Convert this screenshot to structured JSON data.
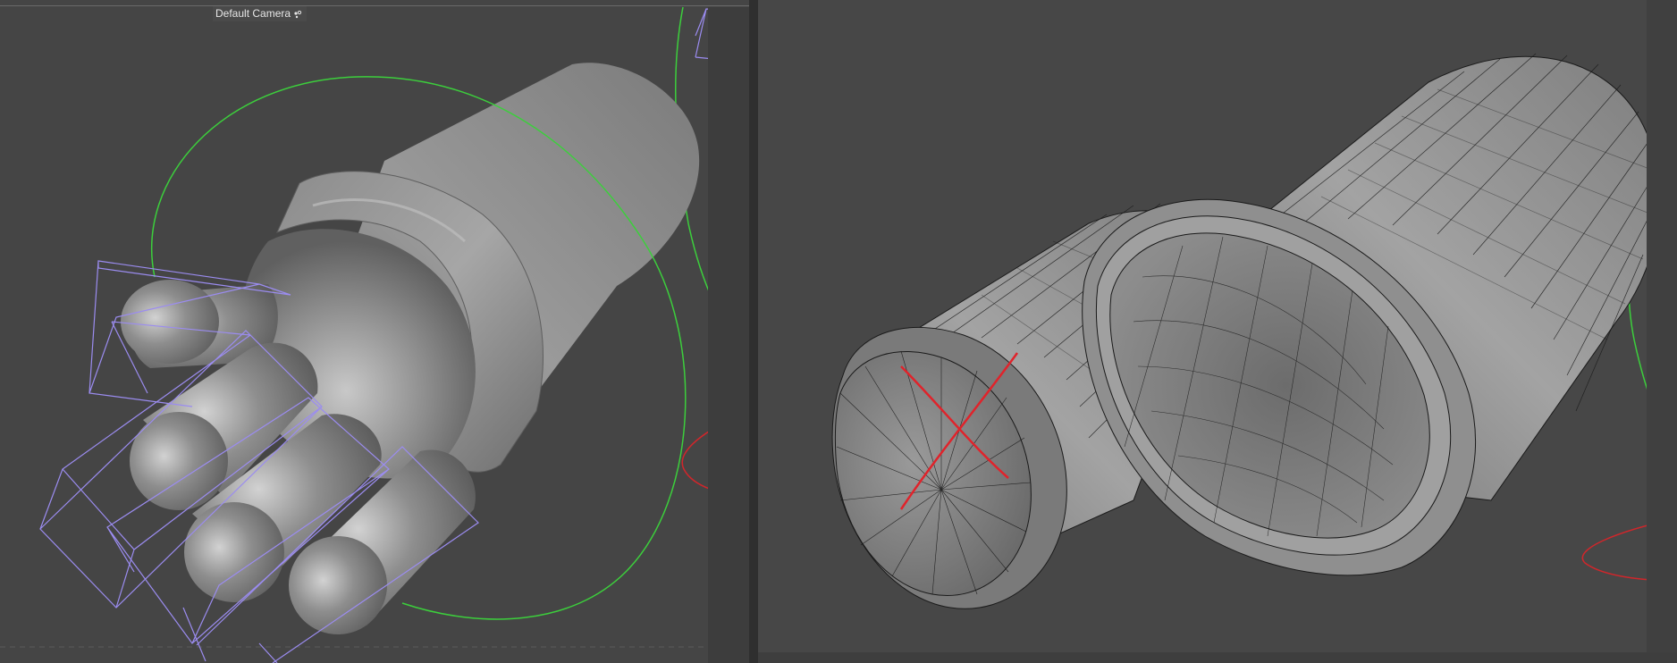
{
  "viewport_left": {
    "camera_label": "Default Camera",
    "camera_icon": "camera-settings-icon"
  },
  "viewport_right": {},
  "colors": {
    "viewport_bg": "#454545",
    "mesh_gray": "#8a8a8a",
    "wire": "#111111",
    "joint_ring": "#3ccf3c",
    "bone_box": "#9b8cf0",
    "highlight_red": "#e0232b"
  }
}
